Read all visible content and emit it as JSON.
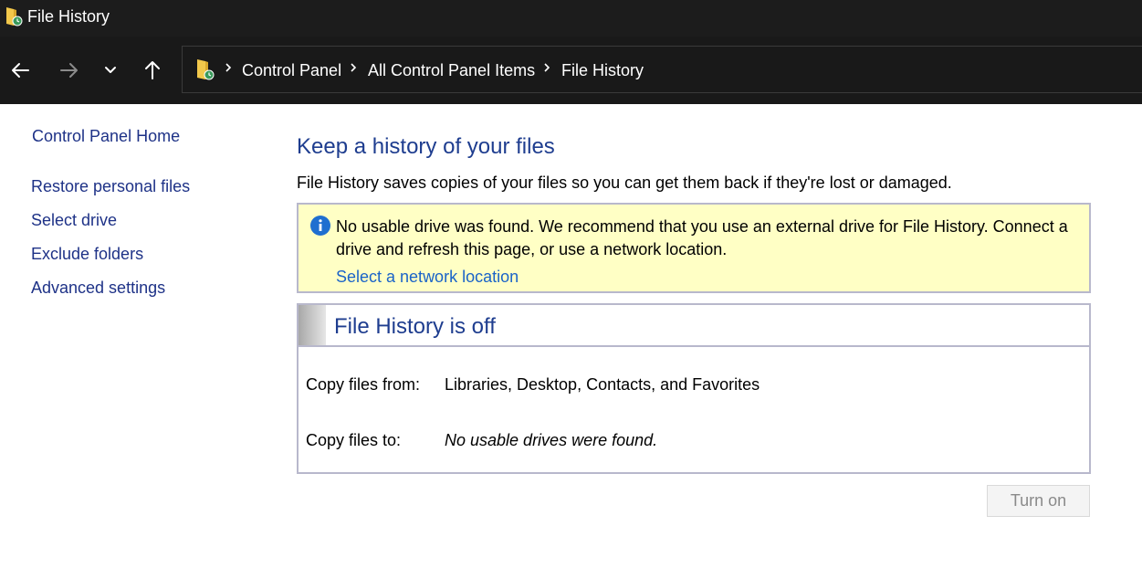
{
  "window": {
    "title": "File History",
    "app_icon": "file-history-icon"
  },
  "nav": {
    "back_icon": "arrow-left-icon",
    "forward_icon": "arrow-right-icon",
    "recent_icon": "chevron-down-icon",
    "up_icon": "arrow-up-icon"
  },
  "address": {
    "location_icon": "file-history-icon",
    "crumbs": [
      "Control Panel",
      "All Control Panel Items",
      "File History"
    ]
  },
  "sidebar": {
    "home": "Control Panel Home",
    "items": [
      "Restore personal files",
      "Select drive",
      "Exclude folders",
      "Advanced settings"
    ]
  },
  "main": {
    "heading": "Keep a history of your files",
    "description": "File History saves copies of your files so you can get them back if they're lost or damaged.",
    "info": {
      "icon": "info-icon",
      "message": "No usable drive was found. We recommend that you use an external drive for File History. Connect a drive and refresh this page, or use a network location.",
      "link": "Select a network location"
    },
    "status": {
      "title": "File History is off",
      "copy_from_label": "Copy files from:",
      "copy_from_value": "Libraries, Desktop, Contacts, and Favorites",
      "copy_to_label": "Copy files to:",
      "copy_to_value": "No usable drives were found."
    },
    "turn_on_label": "Turn on"
  },
  "colors": {
    "titlebar_bg": "#1c1c1c",
    "navbar_bg": "#191919",
    "link": "#1e3287",
    "heading": "#1e3d8f",
    "info_bg": "#ffffc5",
    "info_link": "#1a63c8",
    "panel_border": "#b8b8cc"
  }
}
